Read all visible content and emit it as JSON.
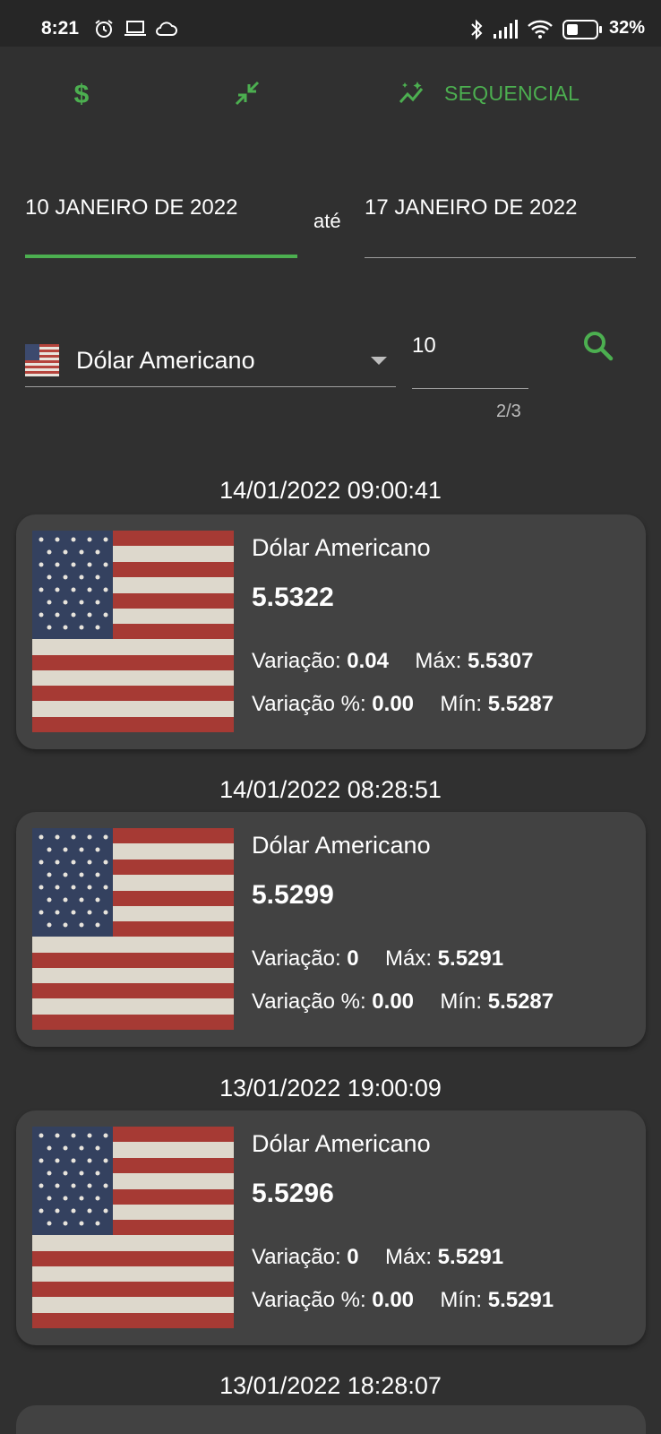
{
  "status_bar": {
    "time": "8:21",
    "battery": "32%",
    "icons": [
      "alarm-icon",
      "laptop-icon",
      "cloud-icon",
      "bluetooth-icon",
      "signal-icon",
      "wifi-icon",
      "battery-icon"
    ]
  },
  "toolbar": {
    "items": [
      {
        "icon": "dollar-icon",
        "label": ""
      },
      {
        "icon": "compress-icon",
        "label": ""
      },
      {
        "icon": "sequence-icon",
        "label": "SEQUENCIAL"
      }
    ],
    "accent_color": "#4caf50"
  },
  "date_range": {
    "start": "10 JANEIRO DE 2022",
    "separator": "até",
    "end": "17 JANEIRO DE 2022"
  },
  "filter": {
    "currency": "Dólar Americano",
    "count_value": "10",
    "count_helper": "2/3"
  },
  "entries": [
    {
      "timestamp": "14/01/2022 09:00:41",
      "name": "Dólar Americano",
      "value": "5.5322",
      "variation_label": "Variação:",
      "variation": "0.04",
      "max_label": "Máx:",
      "max": "5.5307",
      "variation_pct_label": "Variação %:",
      "variation_pct": "0.00",
      "min_label": "Mín:",
      "min": "5.5287"
    },
    {
      "timestamp": "14/01/2022 08:28:51",
      "name": "Dólar Americano",
      "value": "5.5299",
      "variation_label": "Variação:",
      "variation": "0",
      "max_label": "Máx:",
      "max": "5.5291",
      "variation_pct_label": "Variação %:",
      "variation_pct": "0.00",
      "min_label": "Mín:",
      "min": "5.5287"
    },
    {
      "timestamp": "13/01/2022 19:00:09",
      "name": "Dólar Americano",
      "value": "5.5296",
      "variation_label": "Variação:",
      "variation": "0",
      "max_label": "Máx:",
      "max": "5.5291",
      "variation_pct_label": "Variação %:",
      "variation_pct": "0.00",
      "min_label": "Mín:",
      "min": "5.5291"
    },
    {
      "timestamp": "13/01/2022 18:28:07"
    }
  ]
}
